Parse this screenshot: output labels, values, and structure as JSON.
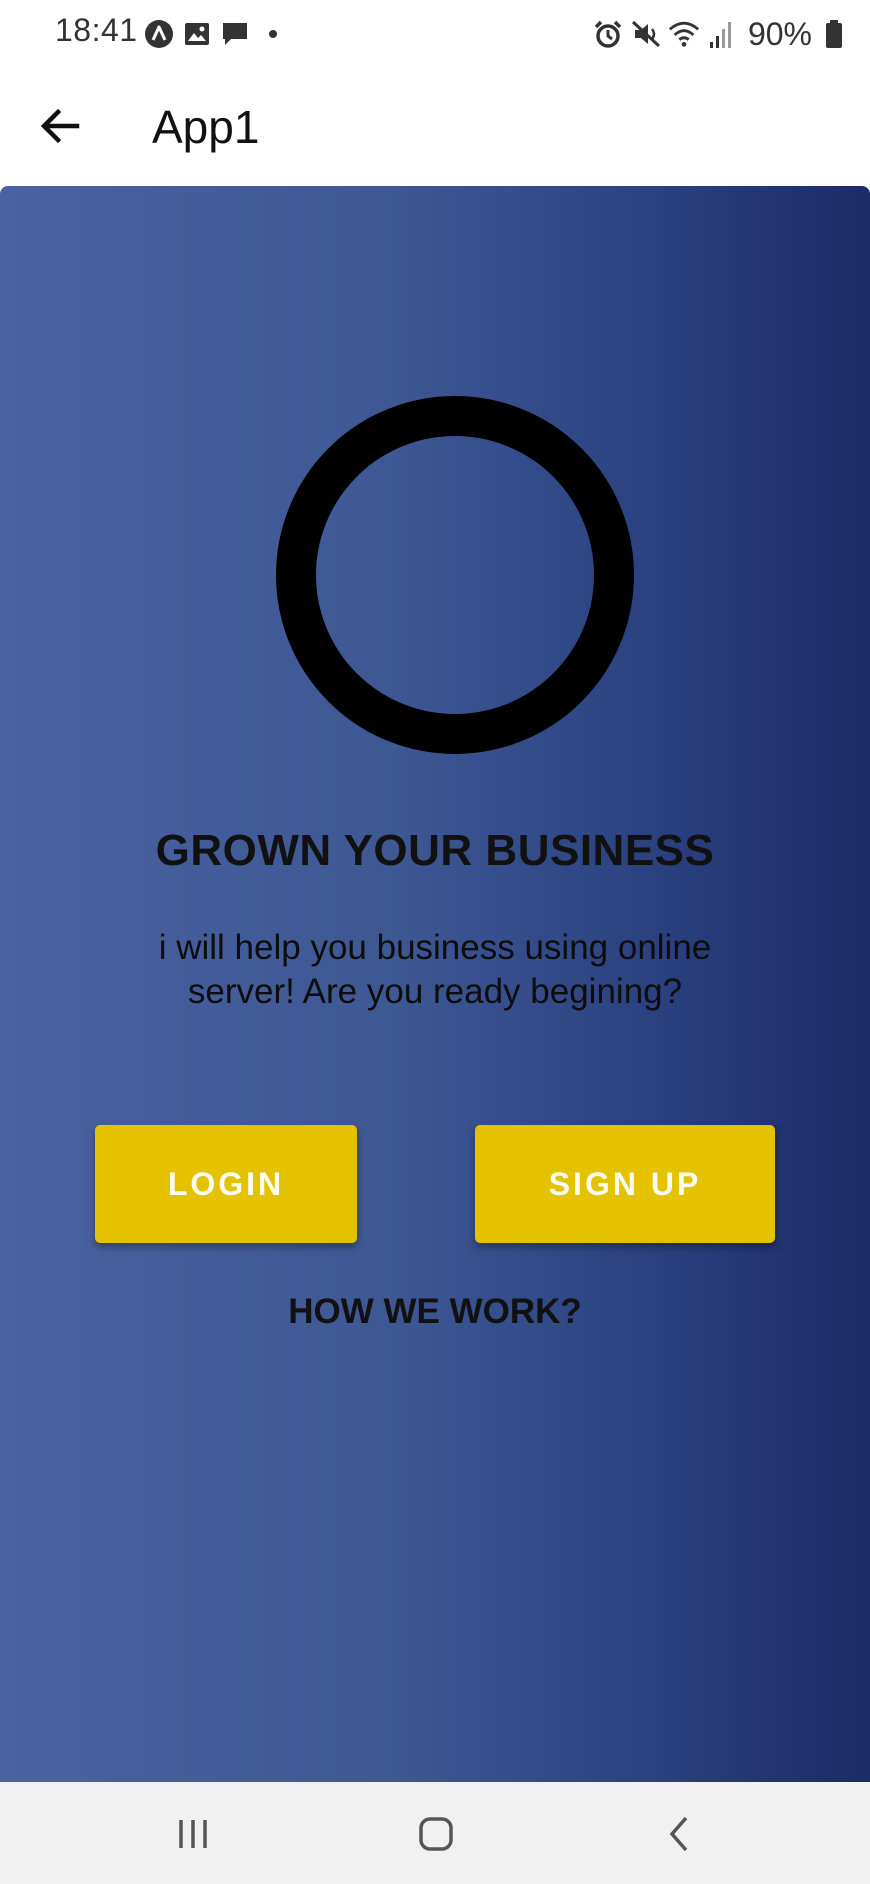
{
  "status_bar": {
    "time": "18:41",
    "battery": "90%",
    "left_icons": [
      "notification-a-icon",
      "image-icon",
      "chat-bubble-icon",
      "dot-icon"
    ],
    "right_icons": [
      "alarm-icon",
      "mute-icon",
      "wifi-icon",
      "signal-icon",
      "battery-icon"
    ]
  },
  "app_bar": {
    "title": "App1"
  },
  "hero": {
    "headline": "GROWN YOUR BUSINESS",
    "subtitle": "i will help you business using online server! Are you ready begining?"
  },
  "actions": {
    "login_label": "LOGIN",
    "signup_label": "SIGN UP",
    "how_label": "HOW WE WORK?"
  },
  "colors": {
    "gradient_start": "#4a62a0",
    "gradient_end": "#1b2b66",
    "button": "#e4c200",
    "button_text": "#fbfbf2"
  },
  "nav_bar": {
    "icons": [
      "recents-icon",
      "home-icon",
      "back-nav-icon"
    ]
  }
}
